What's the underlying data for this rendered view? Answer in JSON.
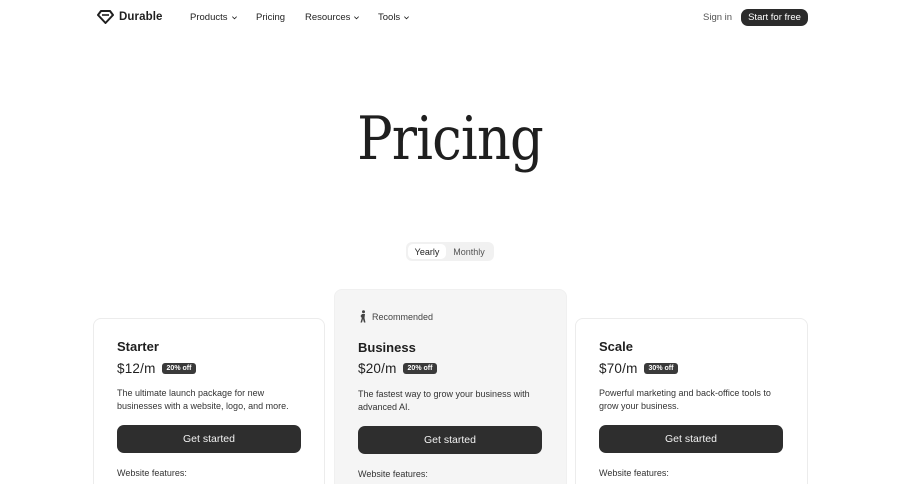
{
  "nav": {
    "brand": "Durable",
    "links": [
      {
        "label": "Products",
        "has_dropdown": true
      },
      {
        "label": "Pricing",
        "has_dropdown": false
      },
      {
        "label": "Resources",
        "has_dropdown": true
      },
      {
        "label": "Tools",
        "has_dropdown": true
      }
    ],
    "sign_in": "Sign in",
    "cta": "Start for free"
  },
  "hero": {
    "title": "Pricing"
  },
  "billing_toggle": {
    "options": [
      "Yearly",
      "Monthly"
    ],
    "selected": "Yearly"
  },
  "plans": [
    {
      "name": "Starter",
      "price": "$12/m",
      "discount": "20% off",
      "description": "The ultimate launch package for new businesses with a website, logo, and more.",
      "cta": "Get started",
      "features_heading": "Website features:"
    },
    {
      "name": "Business",
      "recommended_label": "Recommended",
      "price": "$20/m",
      "discount": "20% off",
      "description": "The fastest way to grow your business with advanced AI.",
      "cta": "Get started",
      "features_heading": "Website features:"
    },
    {
      "name": "Scale",
      "price": "$70/m",
      "discount": "30% off",
      "description": "Powerful marketing and back-office tools to grow your business.",
      "cta": "Get started",
      "features_heading": "Website features:"
    }
  ],
  "colors": {
    "dark_button": "#2e2e2e",
    "badge": "#3a3a3a",
    "highlight_card": "#f5f5f5"
  }
}
